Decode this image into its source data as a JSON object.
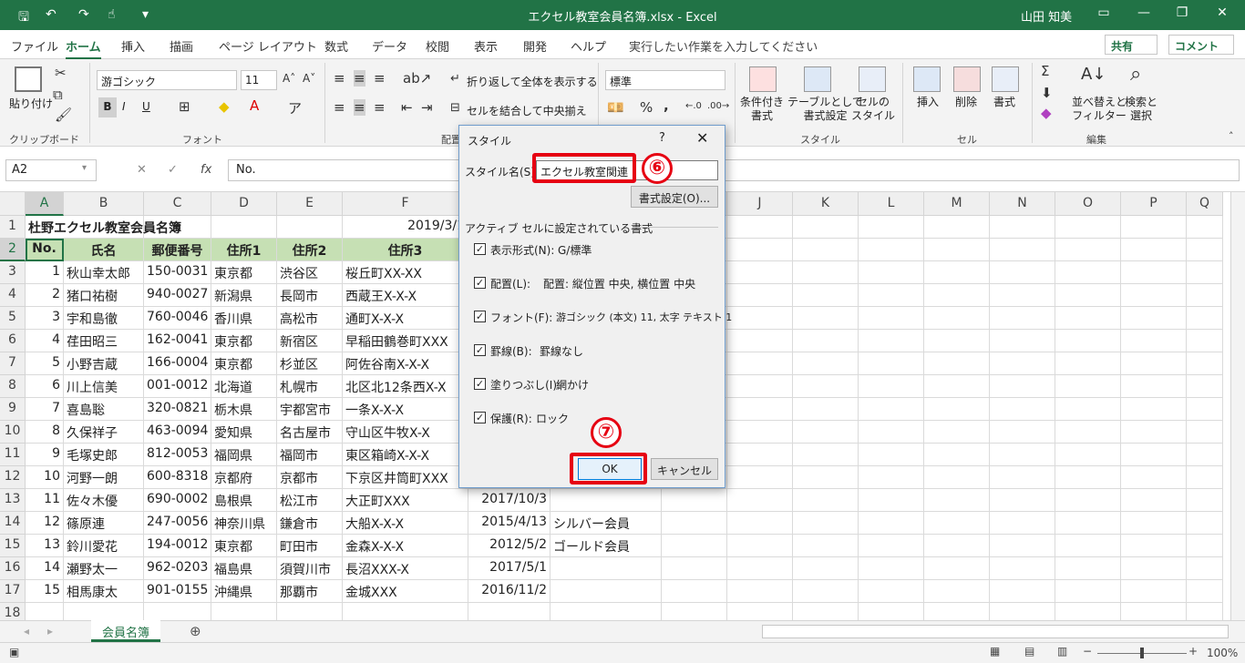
{
  "titlebar": {
    "title": "エクセル教室会員名簿.xlsx  -  Excel",
    "user": "山田 知美"
  },
  "menu": {
    "tabs": [
      "ファイル",
      "ホーム",
      "挿入",
      "描画",
      "ページ レイアウト",
      "数式",
      "データ",
      "校閲",
      "表示",
      "開発",
      "ヘルプ"
    ],
    "tellme": "実行したい作業を入力してください",
    "share": "共有",
    "comment": "コメント"
  },
  "ribbon": {
    "clipboard": {
      "paste": "貼り付け",
      "label": "クリップボード"
    },
    "font": {
      "name": "游ゴシック",
      "size": "11",
      "label": "フォント",
      "bold": "B",
      "italic": "I",
      "underline": "U"
    },
    "alignment": {
      "wrap": "折り返して全体を表示する",
      "merge": "セルを結合して中央揃え",
      "label": "配置"
    },
    "number": {
      "format": "標準",
      "percent": "%",
      "comma": ","
    },
    "styles": {
      "conditional": "条件付き\n書式",
      "table": "テーブルとして\n書式設定",
      "cellstyle": "セルの\nスタイル",
      "label": "スタイル"
    },
    "cells": {
      "insert": "挿入",
      "delete": "削除",
      "format": "書式",
      "label": "セル"
    },
    "editing": {
      "sort": "並べ替えと\nフィルター",
      "find": "検索と\n選択",
      "label": "編集"
    }
  },
  "formula": {
    "namebox": "A2",
    "content": "No."
  },
  "columns": [
    "A",
    "B",
    "C",
    "D",
    "E",
    "F",
    "G",
    "H",
    "I",
    "J",
    "K",
    "L",
    "M",
    "N",
    "O",
    "P",
    "Q"
  ],
  "rows": [
    [
      "杜野エクセル教室会員名簿",
      "",
      "",
      "",
      "",
      "2019/3/1",
      "",
      ""
    ],
    [
      "No.",
      "氏名",
      "郵便番号",
      "住所1",
      "住所2",
      "住所3",
      "",
      ""
    ],
    [
      "1",
      "秋山幸太郎",
      "150-0031",
      "東京都",
      "渋谷区",
      "桜丘町XX-XX",
      "",
      ""
    ],
    [
      "2",
      "猪口祐樹",
      "940-0027",
      "新潟県",
      "長岡市",
      "西蔵王X-X-X",
      "",
      ""
    ],
    [
      "3",
      "宇和島徹",
      "760-0046",
      "香川県",
      "高松市",
      "通町X-X-X",
      "",
      ""
    ],
    [
      "4",
      "荏田昭三",
      "162-0041",
      "東京都",
      "新宿区",
      "早稲田鶴巻町XXX",
      "",
      ""
    ],
    [
      "5",
      "小野吉蔵",
      "166-0004",
      "東京都",
      "杉並区",
      "阿佐谷南X-X-X",
      "",
      ""
    ],
    [
      "6",
      "川上信美",
      "001-0012",
      "北海道",
      "札幌市",
      "北区北12条西X-X",
      "",
      ""
    ],
    [
      "7",
      "喜島聡",
      "320-0821",
      "栃木県",
      "宇都宮市",
      "一条X-X-X",
      "",
      ""
    ],
    [
      "8",
      "久保祥子",
      "463-0094",
      "愛知県",
      "名古屋市",
      "守山区牛牧X-X",
      "",
      ""
    ],
    [
      "9",
      "毛塚史郎",
      "812-0053",
      "福岡県",
      "福岡市",
      "東区箱崎X-X-X",
      "",
      ""
    ],
    [
      "10",
      "河野一朗",
      "600-8318",
      "京都府",
      "京都市",
      "下京区井筒町XXX",
      "",
      ""
    ],
    [
      "11",
      "佐々木優",
      "690-0002",
      "島根県",
      "松江市",
      "大正町XXX",
      "2017/10/3",
      ""
    ],
    [
      "12",
      "篠原連",
      "247-0056",
      "神奈川県",
      "鎌倉市",
      "大船X-X-X",
      "2015/4/13",
      "シルバー会員"
    ],
    [
      "13",
      "鈴川愛花",
      "194-0012",
      "東京都",
      "町田市",
      "金森X-X-X",
      "2012/5/2",
      "ゴールド会員"
    ],
    [
      "14",
      "瀬野太一",
      "962-0203",
      "福島県",
      "須賀川市",
      "長沼XXX-X",
      "2017/5/1",
      ""
    ],
    [
      "15",
      "相馬康太",
      "901-0155",
      "沖縄県",
      "那覇市",
      "金城XXX",
      "2016/11/2",
      ""
    ],
    [
      "",
      "",
      "",
      "",
      "",
      "",
      "",
      ""
    ]
  ],
  "sheet": {
    "tab": "会員名簿",
    "zoom": "100%"
  },
  "dialog": {
    "title": "スタイル",
    "help": "?",
    "close": "✕",
    "name_label": "スタイル名(S):",
    "name_value": "エクセル教室関連",
    "format_button": "書式設定(O)...",
    "section": "アクティブ セルに設定されている書式",
    "items": [
      {
        "label": "表示形式(N):",
        "value": "G/標準"
      },
      {
        "label": "配置(L):",
        "value": "配置: 縦位置 中央, 横位置 中央"
      },
      {
        "label": "フォント(F):",
        "value": "游ゴシック (本文) 11, 太字 テキスト 1"
      },
      {
        "label": "罫線(B):",
        "value": "罫線なし"
      },
      {
        "label": "塗りつぶし(I):",
        "value": "網かけ"
      },
      {
        "label": "保護(R):",
        "value": "ロック"
      }
    ],
    "ok": "OK",
    "cancel": "キャンセル"
  },
  "annotations": {
    "step6": "⑥",
    "step7": "⑦"
  },
  "colors": {
    "accent": "#217346",
    "header_fill": "#c6e0b4",
    "highlight": "#e60012"
  }
}
